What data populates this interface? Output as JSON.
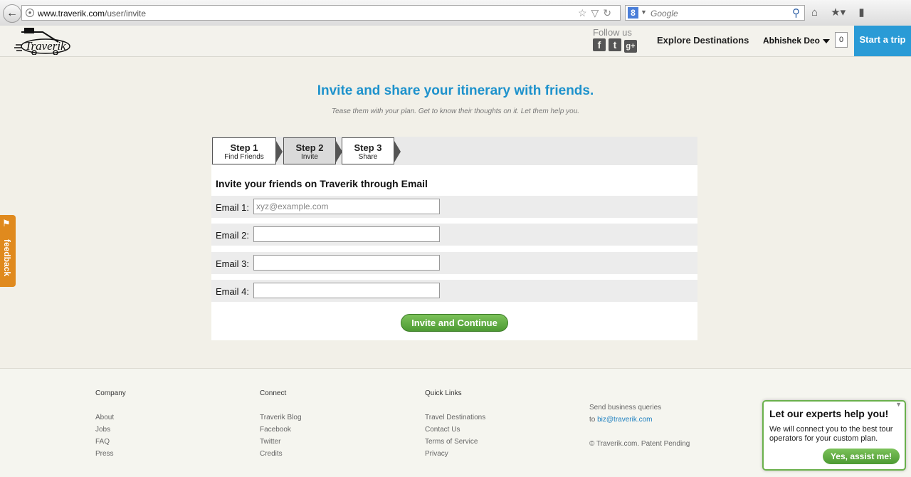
{
  "browser": {
    "url_domain": "www.traverik.com",
    "url_path": "/user/invite",
    "search_placeholder": "Google"
  },
  "header": {
    "logo_text": "Traverik",
    "follow_label": "Follow us",
    "social": {
      "facebook": "f",
      "twitter": "t",
      "googleplus": "g+"
    },
    "explore_label": "Explore Destinations",
    "user_name": "Abhishek Deo",
    "count": "0",
    "start_trip": "Start a trip"
  },
  "main": {
    "title": "Invite and share your itinerary with friends.",
    "subtitle": "Tease them with your plan. Get to know their thoughts on it. Let them help you.",
    "steps": [
      {
        "title": "Step 1",
        "sub": "Find Friends"
      },
      {
        "title": "Step 2",
        "sub": "Invite"
      },
      {
        "title": "Step 3",
        "sub": "Share"
      }
    ],
    "active_step": 2,
    "form_heading": "Invite your friends on Traverik through Email",
    "emails": [
      {
        "label": "Email 1:",
        "placeholder": "xyz@example.com",
        "value": ""
      },
      {
        "label": "Email 2:",
        "placeholder": "",
        "value": ""
      },
      {
        "label": "Email 3:",
        "placeholder": "",
        "value": ""
      },
      {
        "label": "Email 4:",
        "placeholder": "",
        "value": ""
      }
    ],
    "invite_button": "Invite and Continue"
  },
  "feedback_label": "feedback",
  "footer": {
    "company": {
      "heading": "Company",
      "links": [
        "About",
        "Jobs",
        "FAQ",
        "Press"
      ]
    },
    "connect": {
      "heading": "Connect",
      "links": [
        "Traverik Blog",
        "Facebook",
        "Twitter",
        "Credits"
      ]
    },
    "quick": {
      "heading": "Quick Links",
      "links": [
        "Travel Destinations",
        "Contact Us",
        "Terms of Service",
        "Privacy"
      ]
    },
    "business_line1": "Send business queries",
    "business_to": "to ",
    "business_email": "biz@traverik.com",
    "copyright": "© Traverik.com. Patent Pending"
  },
  "expert": {
    "title": "Let our experts help you!",
    "text": "We will connect you to the best tour operators for your custom plan.",
    "button": "Yes, assist me!"
  },
  "colors": {
    "accent_blue": "#1e92cc",
    "start_trip_bg": "#2a9bd6",
    "button_green": "#5aa83d",
    "feedback_orange": "#e08a1e"
  }
}
